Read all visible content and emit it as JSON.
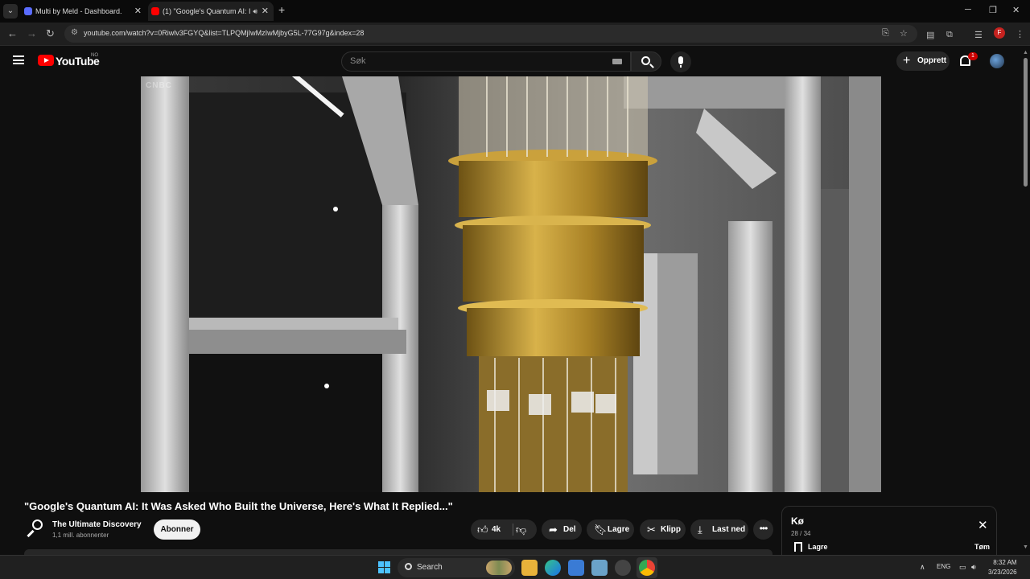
{
  "browser": {
    "tabs": [
      {
        "title": "Multi by Meld - Dashboard.",
        "active": false
      },
      {
        "title": "(1) \"Google's Quantum AI: I",
        "active": true
      }
    ],
    "url": "youtube.com/watch?v=0Riwlv3FGYQ&list=TLPQMjIwMzIwMjbyG5L-77G97g&index=28"
  },
  "youtube": {
    "logo_text": "YouTube",
    "region": "NO",
    "search_placeholder": "Søk",
    "create_label": "Opprett",
    "notification_count": "1"
  },
  "player": {
    "watermark": "CNBC"
  },
  "video": {
    "title": "\"Google's Quantum AI: It Was Asked Who Built the Universe, Here's What It Replied...\"",
    "channel": "The Ultimate Discovery",
    "subscribers": "1,1 mill. abonnenter",
    "subscribe_label": "Abonner",
    "likes": "4k",
    "share_label": "Del",
    "save_label": "Lagre",
    "clip_label": "Klipp",
    "download_label": "Last ned"
  },
  "queue": {
    "title": "Kø",
    "position": "28 / 34",
    "save_label": "Lagre",
    "clear_label": "Tøm"
  },
  "taskbar": {
    "search_label": "Search",
    "language": "ENG",
    "time": "8:32 AM",
    "date": "3/23/2026"
  },
  "colors": {
    "accent_red": "#ff0000",
    "background": "#0f0f0f",
    "pill": "#272727"
  }
}
